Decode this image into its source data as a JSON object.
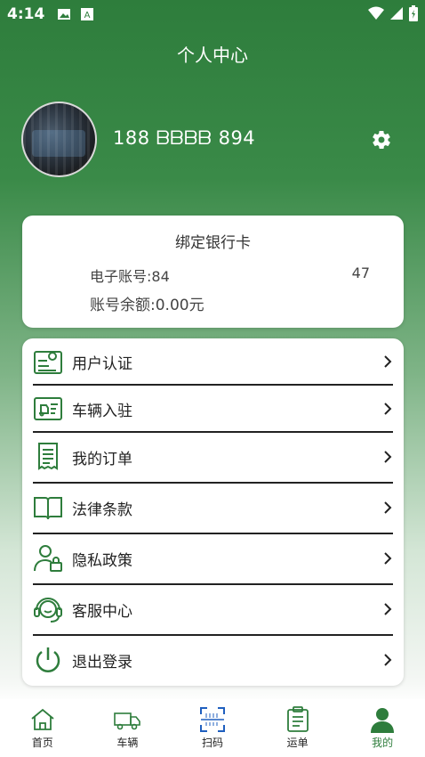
{
  "status": {
    "time": "4:14"
  },
  "header": {
    "title": "个人中心"
  },
  "profile": {
    "phone": "188 ᗷᗷᗷᗷ 894"
  },
  "bank": {
    "title": "绑定银行卡",
    "account_label": "电子账号:84",
    "account_tail": "47",
    "balance": "账号余额:0.00元"
  },
  "menu": {
    "items": [
      {
        "label": "用户认证",
        "icon": "id-card-icon"
      },
      {
        "label": "车辆入驻",
        "icon": "vehicle-license-icon"
      },
      {
        "label": "我的订单",
        "icon": "receipt-icon"
      },
      {
        "label": "法律条款",
        "icon": "book-icon"
      },
      {
        "label": "隐私政策",
        "icon": "user-lock-icon"
      },
      {
        "label": "客服中心",
        "icon": "headset-icon"
      },
      {
        "label": "退出登录",
        "icon": "power-icon"
      }
    ]
  },
  "tabs": [
    {
      "label": "首页",
      "icon": "home-icon"
    },
    {
      "label": "车辆",
      "icon": "truck-icon"
    },
    {
      "label": "扫码",
      "icon": "scan-icon"
    },
    {
      "label": "运单",
      "icon": "clipboard-icon"
    },
    {
      "label": "我的",
      "icon": "person-icon"
    }
  ],
  "colors": {
    "accent": "#2e7d3c",
    "scan_accent": "#1f5fbf"
  }
}
